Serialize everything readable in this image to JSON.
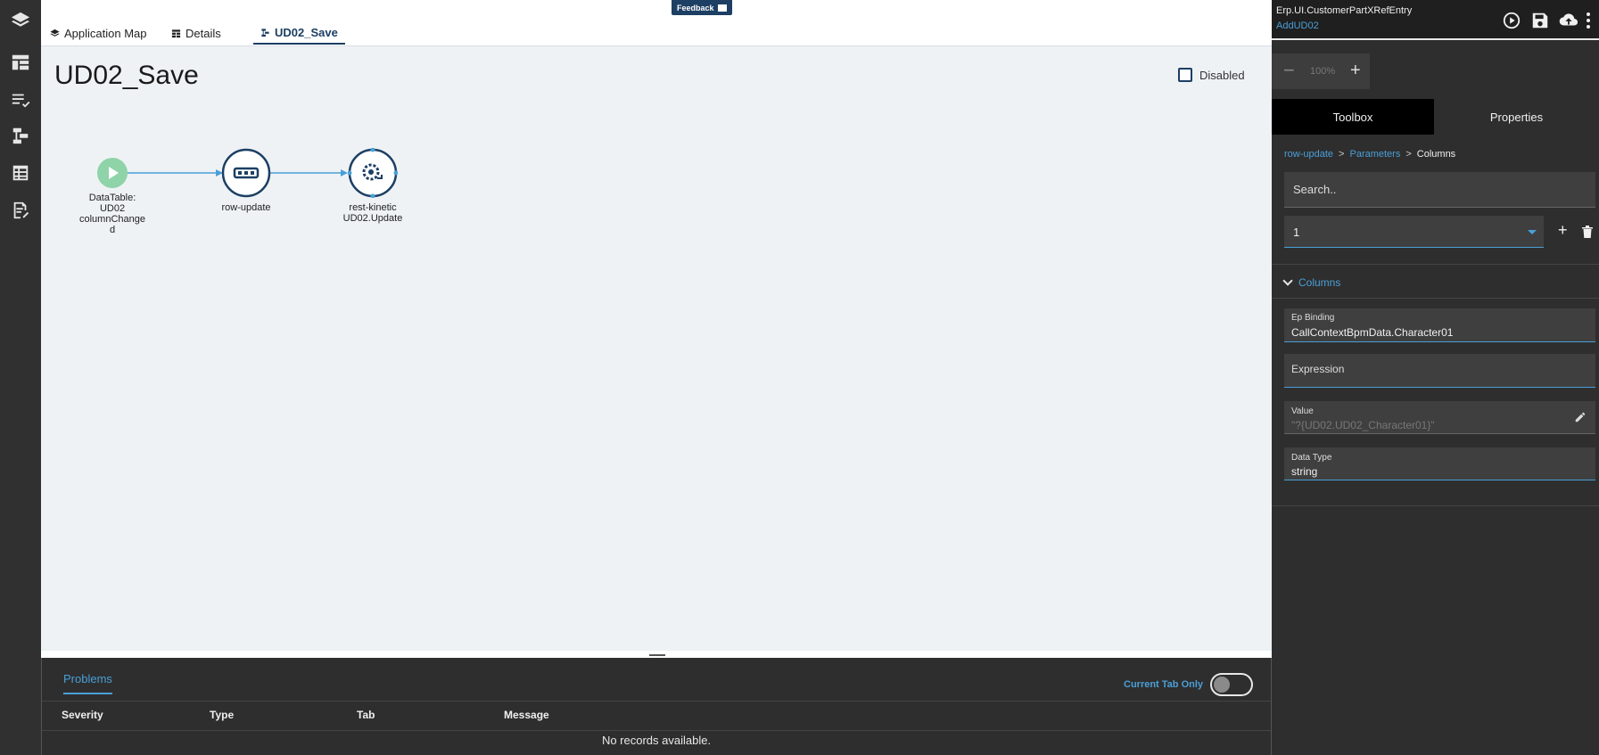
{
  "feedback_label": "Feedback",
  "tabs": [
    {
      "label": "Application Map",
      "icon": "layers-icon"
    },
    {
      "label": "Details",
      "icon": "table-icon"
    },
    {
      "label": "UD02_Save",
      "icon": "workflow-icon",
      "active": true
    }
  ],
  "canvas": {
    "title": "UD02_Save",
    "disabled_label": "Disabled",
    "nodes": [
      {
        "label": "DataTable:\nUD02\ncolumnChange\nd",
        "icon": "play-icon"
      },
      {
        "label": "row-update",
        "icon": "dots-icon"
      },
      {
        "label": "rest-kinetic\nUD02.Update",
        "icon": "gear-sync-icon"
      }
    ]
  },
  "problems": {
    "tab_label": "Problems",
    "current_tab_only_label": "Current Tab Only",
    "columns": [
      "Severity",
      "Type",
      "Tab",
      "Message"
    ],
    "empty_message": "No records available."
  },
  "right_panel": {
    "title": "Erp.UI.CustomerPartXRefEntry",
    "subtitle": "AddUD02",
    "zoom": "100%",
    "tabs": {
      "toolbox": "Toolbox",
      "properties": "Properties"
    },
    "breadcrumb": {
      "part1": "row-update",
      "sep": ">",
      "part2": "Parameters",
      "current": "Columns"
    },
    "search_placeholder": "Search..",
    "select_value": "1",
    "section_label": "Columns",
    "fields": {
      "ep_binding_label": "Ep Binding",
      "ep_binding_value": "CallContextBpmData.Character01",
      "expression_label": "Expression",
      "value_label": "Value",
      "value_value": "\"?{UD02.UD02_Character01}\"",
      "data_type_label": "Data Type",
      "data_type_value": "string"
    }
  },
  "colors": {
    "accent": "#4a9fd8",
    "navy": "#1c3f63",
    "start_node": "#8fd3a8",
    "dark_panel": "#2e2e2e",
    "canvas_bg": "#eef2f5"
  }
}
